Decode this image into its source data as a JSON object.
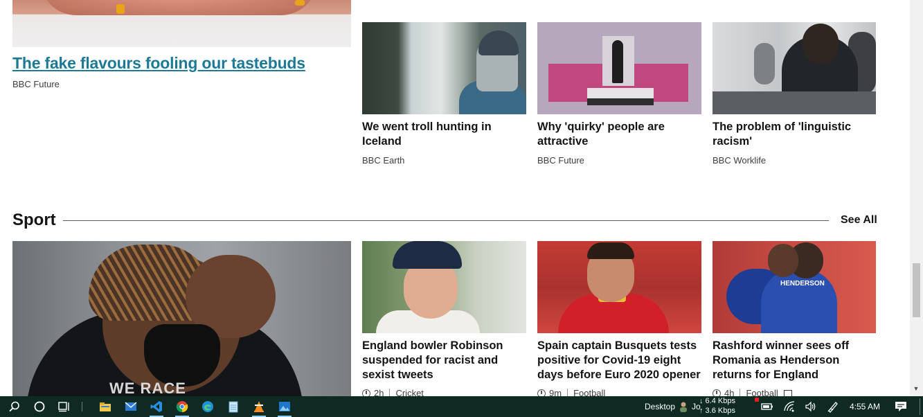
{
  "top_story": {
    "headline": "The fake flavours fooling our tastebuds",
    "source": "BBC Future"
  },
  "cards_top": [
    {
      "title": "We went troll hunting in Iceland",
      "source": "BBC Earth"
    },
    {
      "title": "Why 'quirky' people are attractive",
      "source": "BBC Future"
    },
    {
      "title": "The problem of 'linguistic racism'",
      "source": "BBC Worklife"
    }
  ],
  "sport": {
    "title": "Sport",
    "see_all": "See All",
    "cards": [
      {
        "title": "England bowler Robinson suspended for racist and sexist tweets",
        "time": "2h",
        "category": "Cricket"
      },
      {
        "title": "Spain captain Busquets tests positive for Covid-19 eight days before Euro 2020 opener",
        "time": "9m",
        "category": "Football"
      },
      {
        "title": "Rashford winner sees off Romania as Henderson returns for England",
        "time": "4h",
        "category": "Football"
      }
    ],
    "image_text": {
      "hamilton": "WE RACE",
      "henderson": "HENDERSON"
    }
  },
  "taskbar": {
    "desktop_label": "Desktop",
    "user_initial": "Jo",
    "net_down": "↓ 6.4 Kbps",
    "net_up": "↑ 3.6 Kbps",
    "clock": "4:55 AM",
    "icons": [
      "search-icon",
      "cortana-icon",
      "task-view-icon",
      "file-explorer-icon",
      "mail-icon",
      "vscode-icon",
      "chrome-icon",
      "edge-icon",
      "notepad-icon",
      "vlc-icon",
      "photos-icon"
    ]
  },
  "colors": {
    "link": "#1d7a96",
    "taskbar": "#0f2a23"
  }
}
